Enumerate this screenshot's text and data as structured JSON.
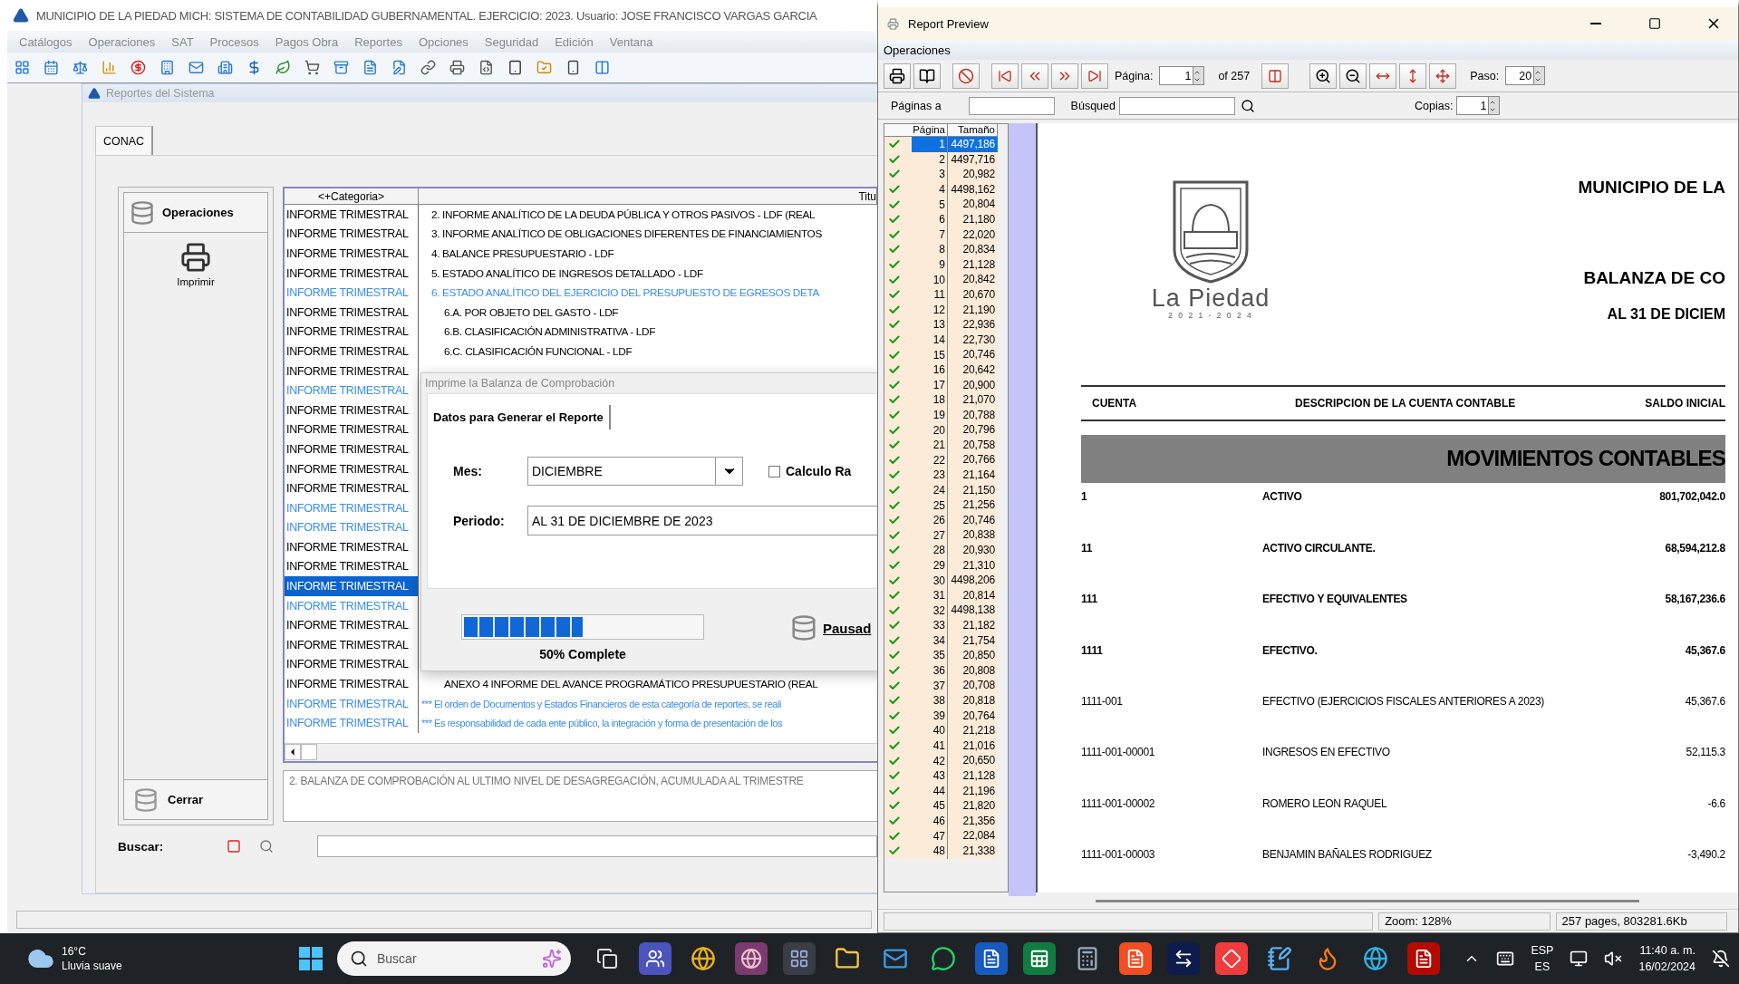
{
  "main_window": {
    "title": "MUNICIPIO DE LA PIEDAD MICH: SISTEMA DE CONTABILIDAD GUBERNAMENTAL. EJERCICIO: 2023. Usuario: JOSE FRANCISCO VARGAS GARCIA",
    "menu": [
      "Catálogos",
      "Operaciones",
      "SAT",
      "Procesos",
      "Pagos Obra",
      "Reportes",
      "Opciones",
      "Seguridad",
      "Edición",
      "Ventana"
    ],
    "child_window": {
      "title": "Reportes del Sistema",
      "tabs": [
        {
          "label": "CONAC",
          "selected": true
        }
      ],
      "operations_panel": {
        "header": "Operaciones",
        "actions": [
          "Imprimir"
        ],
        "close_button": "Cerrar"
      },
      "grid": {
        "columns": [
          "<+Categoria>",
          "Titu"
        ],
        "rows": [
          {
            "category": "INFORME TRIMESTRAL",
            "title": "2. INFORME ANALÍTICO DE LA DEUDA PÚBLICA Y OTROS PASIVOS - LDF (REAL",
            "kind": "item",
            "highlight": false,
            "selected": false
          },
          {
            "category": "INFORME TRIMESTRAL",
            "title": "3. INFORME ANALÍTICO DE OBLIGACIONES DIFERENTES DE FINANCIAMIENTOS",
            "kind": "item",
            "highlight": false,
            "selected": false
          },
          {
            "category": "INFORME TRIMESTRAL",
            "title": "4. BALANCE PRESUPUESTARIO - LDF",
            "kind": "item",
            "highlight": false,
            "selected": false
          },
          {
            "category": "INFORME TRIMESTRAL",
            "title": "5. ESTADO ANALÍTICO DE INGRESOS DETALLADO - LDF",
            "kind": "item",
            "highlight": false,
            "selected": false
          },
          {
            "category": "INFORME TRIMESTRAL",
            "title": "6. ESTADO ANALÍTICO DEL EJERCICIO DEL PRESUPUESTO DE EGRESOS DETA",
            "kind": "item",
            "highlight": true,
            "selected": false
          },
          {
            "category": "INFORME TRIMESTRAL",
            "title": "6.A. POR OBJETO DEL GASTO - LDF",
            "kind": "subitem",
            "highlight": false,
            "selected": false
          },
          {
            "category": "INFORME TRIMESTRAL",
            "title": "6.B. CLASIFICACIÓN ADMINISTRATIVA - LDF",
            "kind": "subitem",
            "highlight": false,
            "selected": false
          },
          {
            "category": "INFORME TRIMESTRAL",
            "title": "6.C. CLASIFICACIÓN FUNCIONAL - LDF",
            "kind": "subitem",
            "highlight": false,
            "selected": false
          },
          {
            "category": "INFORME TRIMESTRAL",
            "highlight": false,
            "selected": false
          },
          {
            "category": "INFORME TRIMESTRAL",
            "highlight": true,
            "selected": false
          },
          {
            "category": "INFORME TRIMESTRAL",
            "highlight": false,
            "selected": false
          },
          {
            "category": "INFORME TRIMESTRAL",
            "highlight": false,
            "selected": false
          },
          {
            "category": "INFORME TRIMESTRAL",
            "highlight": false,
            "selected": false
          },
          {
            "category": "INFORME TRIMESTRAL",
            "highlight": false,
            "selected": false
          },
          {
            "category": "INFORME TRIMESTRAL",
            "highlight": false,
            "selected": false
          },
          {
            "category": "INFORME TRIMESTRAL",
            "highlight": true,
            "selected": false
          },
          {
            "category": "INFORME TRIMESTRAL",
            "highlight": true,
            "selected": false
          },
          {
            "category": "INFORME TRIMESTRAL",
            "highlight": false,
            "selected": false
          },
          {
            "category": "INFORME TRIMESTRAL",
            "highlight": false,
            "selected": false
          },
          {
            "category": "INFORME TRIMESTRAL",
            "highlight": false,
            "selected": true
          },
          {
            "category": "INFORME TRIMESTRAL",
            "highlight": true,
            "selected": false
          },
          {
            "category": "INFORME TRIMESTRAL",
            "highlight": false,
            "selected": false
          },
          {
            "category": "INFORME TRIMESTRAL",
            "highlight": false,
            "selected": false
          },
          {
            "category": "INFORME TRIMESTRAL",
            "highlight": false,
            "selected": false
          },
          {
            "category": "INFORME TRIMESTRAL",
            "title": "ANEXO 4 INFORME DEL AVANCE PROGRAMÁTICO PRESUPUESTARIO (REAL",
            "kind": "subitem",
            "highlight": false,
            "selected": false
          },
          {
            "category": "INFORME TRIMESTRAL",
            "title": "*** El orden de Documentos y Estados Financieros de esta categoría de reportes, se reali",
            "kind": "note",
            "highlight": true,
            "selected": false
          },
          {
            "category": "INFORME TRIMESTRAL",
            "title": "*** Es responsabilidad de cada ente público, la integración y forma de presentación de los",
            "kind": "note",
            "highlight": true,
            "selected": false
          }
        ]
      },
      "description": "2. BALANZA DE COMPROBACIÓN AL ULTIMO NIVEL DE DESAGREGACIÓN, ACUMULADA AL TRIMESTRE",
      "search": {
        "label": "Buscar:"
      },
      "dialog": {
        "title": "Imprime la Balanza de Comprobación",
        "tab": "Datos para Generar el Reporte",
        "month_label": "Mes:",
        "month_value": "DICIEMBRE",
        "calc_checkbox": {
          "label": "Calculo Ra",
          "checked": false
        },
        "period_label": "Periodo:",
        "period_value": "AL 31 DE DICIEMBRE DE 2023",
        "progress": {
          "level": 0.5,
          "label": "50% Complete"
        },
        "pause_button": "Pausad"
      }
    }
  },
  "report_preview": {
    "title": "Report Preview",
    "menu": [
      "Operaciones"
    ],
    "toolbar": {
      "page_label": "Página:",
      "page_value": "1",
      "page_total": "of 257",
      "step_label": "Paso:",
      "step_value": "20"
    },
    "toolbar2": {
      "pages_label": "Páginas a",
      "search_label": "Búsqued",
      "copies_label": "Copias:",
      "copies_value": "1"
    },
    "page_list": {
      "columns": [
        "Página",
        "Tamaño"
      ],
      "rows": [
        {
          "page": "1",
          "size": "4497,186",
          "checked": true,
          "selected": true
        },
        {
          "page": "2",
          "size": "4497,716",
          "checked": true,
          "selected": false
        },
        {
          "page": "3",
          "size": "20,982",
          "checked": true,
          "selected": false
        },
        {
          "page": "4",
          "size": "4498,162",
          "checked": true,
          "selected": false
        },
        {
          "page": "5",
          "size": "20,804",
          "checked": true,
          "selected": false
        },
        {
          "page": "6",
          "size": "21,180",
          "checked": true,
          "selected": false
        },
        {
          "page": "7",
          "size": "22,020",
          "checked": true,
          "selected": false
        },
        {
          "page": "8",
          "size": "20,834",
          "checked": true,
          "selected": false
        },
        {
          "page": "9",
          "size": "21,128",
          "checked": true,
          "selected": false
        },
        {
          "page": "10",
          "size": "20,842",
          "checked": true,
          "selected": false
        },
        {
          "page": "11",
          "size": "20,670",
          "checked": true,
          "selected": false
        },
        {
          "page": "12",
          "size": "21,190",
          "checked": true,
          "selected": false
        },
        {
          "page": "13",
          "size": "22,936",
          "checked": true,
          "selected": false
        },
        {
          "page": "14",
          "size": "22,730",
          "checked": true,
          "selected": false
        },
        {
          "page": "15",
          "size": "20,746",
          "checked": true,
          "selected": false
        },
        {
          "page": "16",
          "size": "20,642",
          "checked": true,
          "selected": false
        },
        {
          "page": "17",
          "size": "20,900",
          "checked": true,
          "selected": false
        },
        {
          "page": "18",
          "size": "21,070",
          "checked": true,
          "selected": false
        },
        {
          "page": "19",
          "size": "20,788",
          "checked": true,
          "selected": false
        },
        {
          "page": "20",
          "size": "20,796",
          "checked": true,
          "selected": false
        },
        {
          "page": "21",
          "size": "20,758",
          "checked": true,
          "selected": false
        },
        {
          "page": "22",
          "size": "20,766",
          "checked": true,
          "selected": false
        },
        {
          "page": "23",
          "size": "21,164",
          "checked": true,
          "selected": false
        },
        {
          "page": "24",
          "size": "21,150",
          "checked": true,
          "selected": false
        },
        {
          "page": "25",
          "size": "21,256",
          "checked": true,
          "selected": false
        },
        {
          "page": "26",
          "size": "20,746",
          "checked": true,
          "selected": false
        },
        {
          "page": "27",
          "size": "20,838",
          "checked": true,
          "selected": false
        },
        {
          "page": "28",
          "size": "20,930",
          "checked": true,
          "selected": false
        },
        {
          "page": "29",
          "size": "21,310",
          "checked": true,
          "selected": false
        },
        {
          "page": "30",
          "size": "4498,206",
          "checked": true,
          "selected": false
        },
        {
          "page": "31",
          "size": "20,814",
          "checked": true,
          "selected": false
        },
        {
          "page": "32",
          "size": "4498,138",
          "checked": true,
          "selected": false
        },
        {
          "page": "33",
          "size": "21,182",
          "checked": true,
          "selected": false
        },
        {
          "page": "34",
          "size": "21,754",
          "checked": true,
          "selected": false
        },
        {
          "page": "35",
          "size": "20,850",
          "checked": true,
          "selected": false
        },
        {
          "page": "36",
          "size": "20,808",
          "checked": true,
          "selected": false
        },
        {
          "page": "37",
          "size": "20,708",
          "checked": true,
          "selected": false
        },
        {
          "page": "38",
          "size": "20,818",
          "checked": true,
          "selected": false
        },
        {
          "page": "39",
          "size": "20,764",
          "checked": true,
          "selected": false
        },
        {
          "page": "40",
          "size": "21,218",
          "checked": true,
          "selected": false
        },
        {
          "page": "41",
          "size": "21,016",
          "checked": true,
          "selected": false
        },
        {
          "page": "42",
          "size": "20,650",
          "checked": true,
          "selected": false
        },
        {
          "page": "43",
          "size": "21,128",
          "checked": true,
          "selected": false
        },
        {
          "page": "44",
          "size": "21,196",
          "checked": true,
          "selected": false
        },
        {
          "page": "45",
          "size": "21,820",
          "checked": true,
          "selected": false
        },
        {
          "page": "46",
          "size": "21,356",
          "checked": true,
          "selected": false
        },
        {
          "page": "47",
          "size": "22,084",
          "checked": true,
          "selected": false
        },
        {
          "page": "48",
          "size": "21,338",
          "checked": true,
          "selected": false
        }
      ]
    },
    "report": {
      "org": "MUNICIPIO DE LA",
      "title": "BALANZA DE CO",
      "period": "AL 31 DE DICIEM",
      "logo_text": "La Piedad",
      "logo_years": "2 0 2 1 - 2 0 2 4",
      "columns": [
        "CUENTA",
        "DESCRIPCION DE LA CUENTA CONTABLE",
        "SALDO INICIAL"
      ],
      "band": "MOVIMIENTOS CONTABLES",
      "rows": [
        {
          "account": "1",
          "description": "ACTIVO",
          "balance": "801,702,042.0",
          "bold": true
        },
        {
          "account": "11",
          "description": "ACTIVO CIRCULANTE.",
          "balance": "68,594,212.8",
          "bold": true
        },
        {
          "account": "111",
          "description": "EFECTIVO Y EQUIVALENTES",
          "balance": "58,167,236.6",
          "bold": true
        },
        {
          "account": "1111",
          "description": "EFECTIVO.",
          "balance": "45,367.6",
          "bold": true
        },
        {
          "account": "1111-001",
          "description": "EFECTIVO (EJERCICIOS FISCALES ANTERIORES A 2023)",
          "balance": "45,367.6",
          "bold": false
        },
        {
          "account": "1111-001-00001",
          "description": "INGRESOS EN EFECTIVO",
          "balance": "52,115.3",
          "bold": false
        },
        {
          "account": "1111-001-00002",
          "description": "ROMERO LEON RAQUEL",
          "balance": "-6.6",
          "bold": false
        },
        {
          "account": "1111-001-00003",
          "description": "BENJAMIN BAÑALES RODRIGUEZ",
          "balance": "-3,490.2",
          "bold": false
        }
      ]
    },
    "status_bar": [
      "Zoom: 128%",
      "257 pages, 803281.6Kb"
    ]
  },
  "taskbar": {
    "weather": {
      "temp": "16°C",
      "condition": "Lluvia suave"
    },
    "search_placeholder": "Buscar",
    "tray": {
      "language": "ESP",
      "layout": "ES",
      "time": "11:40 a. m.",
      "date": "16/02/2024"
    }
  }
}
